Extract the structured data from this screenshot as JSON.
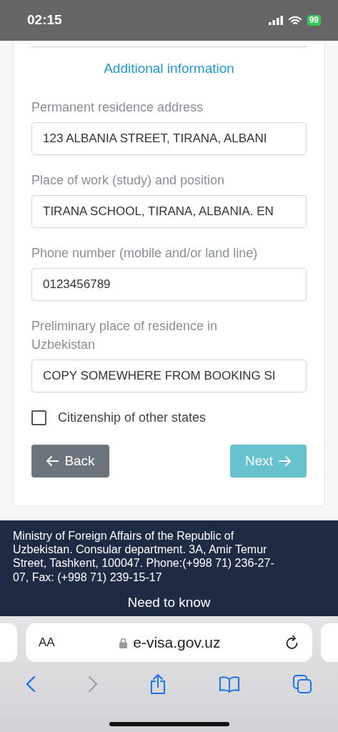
{
  "status_bar": {
    "time": "02:15",
    "battery": "99"
  },
  "section_title": "Additional information",
  "fields": [
    {
      "label": "Permanent residence address",
      "value": "123 ALBANIA STREET, TIRANA, ALBANI"
    },
    {
      "label": "Place of work (study) and position",
      "value": "TIRANA SCHOOL, TIRANA, ALBANIA. EN"
    },
    {
      "label": "Phone number (mobile and/or land line)",
      "value": "0123456789"
    },
    {
      "label": "Preliminary place of residence in Uzbekistan",
      "value": "COPY SOMEWHERE FROM BOOKING SI"
    }
  ],
  "checkbox": {
    "label": "Citizenship of other states",
    "checked": false
  },
  "buttons": [
    {
      "label": "Back",
      "kind": "back",
      "disabled": false
    },
    {
      "label": "Next",
      "kind": "next",
      "disabled": true
    }
  ],
  "footer": {
    "text": "Ministry of Foreign Affairs of the Republic of Uzbekistan. Consular department. 3A, Amir Temur Street, Tashkent, 100047. Phone:(+998 71) 236-27-07, Fax: (+998 71) 239-15-17",
    "link": "Need to know"
  },
  "browser": {
    "text_size": "AA",
    "url": "e-visa.gov.uz"
  }
}
